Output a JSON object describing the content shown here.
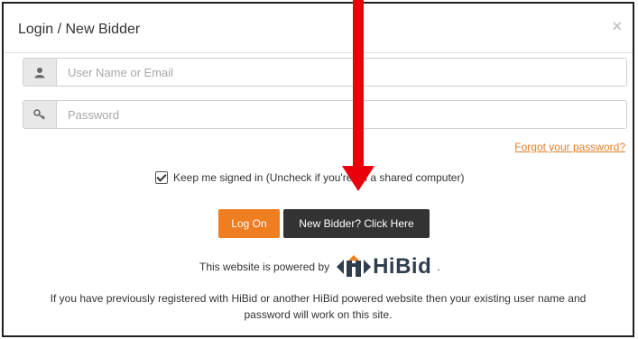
{
  "dialog": {
    "title": "Login / New Bidder",
    "close_symbol": "×"
  },
  "form": {
    "username": {
      "placeholder": "User Name or Email",
      "icon": "user-icon"
    },
    "password": {
      "placeholder": "Password",
      "icon": "key-icon"
    },
    "forgot_link": "Forgot your password?",
    "remember": {
      "checked": true,
      "label": "Keep me signed in (Uncheck if you're on a shared computer)"
    },
    "buttons": {
      "logon": "Log On",
      "new_bidder": "New Bidder? Click Here"
    }
  },
  "powered_by": {
    "text": "This website is powered by",
    "brand": "HiBid",
    "suffix": "."
  },
  "footer": {
    "line1": "If you have previously registered with HiBid or another HiBid powered website then your existing user name and",
    "line2": "password will work on this site."
  },
  "colors": {
    "accent_orange": "#ef7d22",
    "dark_button": "#333333",
    "annotation_arrow": "#e8000b",
    "brand_text": "#2f3e4e"
  }
}
